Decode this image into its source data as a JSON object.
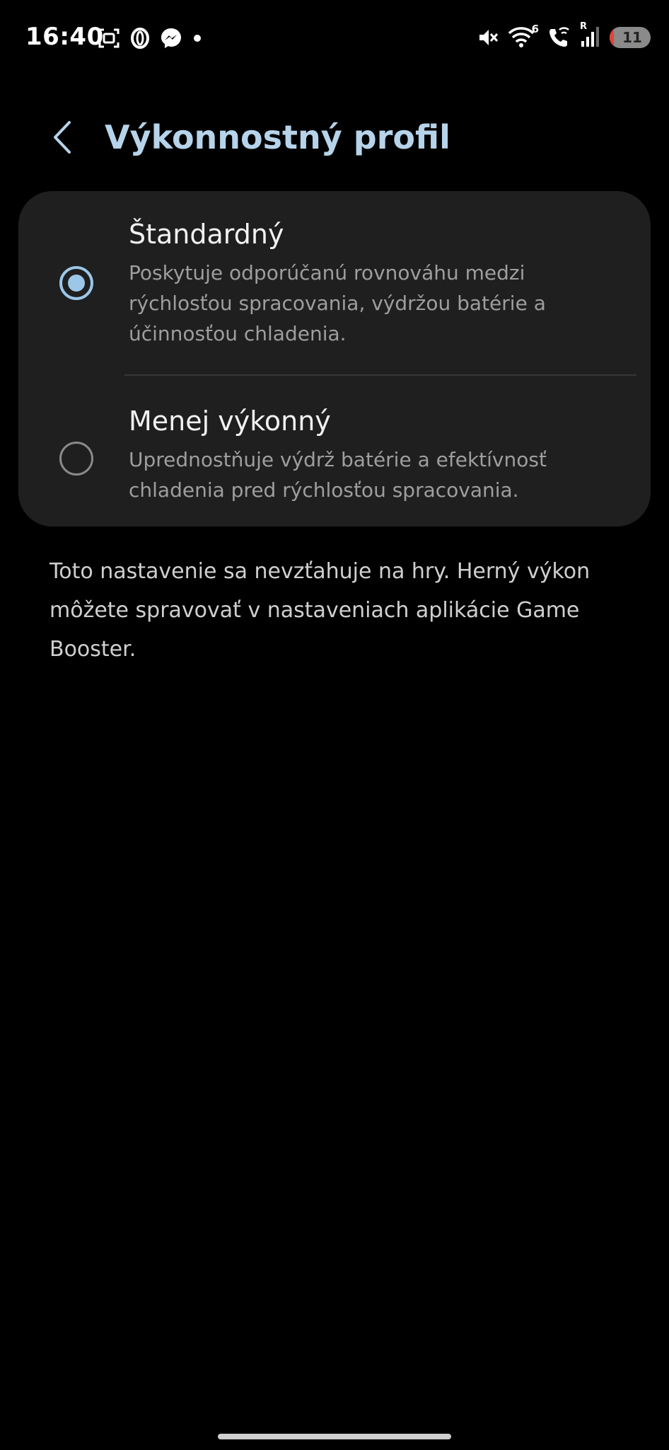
{
  "status_bar": {
    "time": "16:40",
    "left_icons": [
      "screenshot-icon",
      "opera-icon",
      "messenger-icon",
      "notification-dot-icon"
    ],
    "right_icons": [
      "mute-icon",
      "wifi-icon",
      "wifi-calling-icon",
      "cellular-signal-icon"
    ],
    "wifi_badge": "6",
    "signal_badge": "R",
    "battery_level": "11",
    "battery_fraction": 0.11,
    "battery_color": "#e0443a"
  },
  "header": {
    "back_icon": "chevron-left-icon",
    "title": "Výkonnostný profil",
    "title_color": "#b6d3ea"
  },
  "options": [
    {
      "title": "Štandardný",
      "description": "Poskytuje odporúčanú rovnováhu medzi rýchlosťou spracovania, výdržou batérie a účinnosťou chladenia.",
      "selected": true
    },
    {
      "title": "Menej výkonný",
      "description": "Uprednostňuje výdrž batérie a efektívnosť chladenia pred rýchlosťou spracovania.",
      "selected": false
    }
  ],
  "note": "Toto nastavenie sa nevzťahuje na hry. Herný výkon môžete spravovať v nastaveniach aplikácie Game Booster.",
  "colors": {
    "background": "#000000",
    "card": "#1f1f1f",
    "accent": "#9cc7e8"
  }
}
